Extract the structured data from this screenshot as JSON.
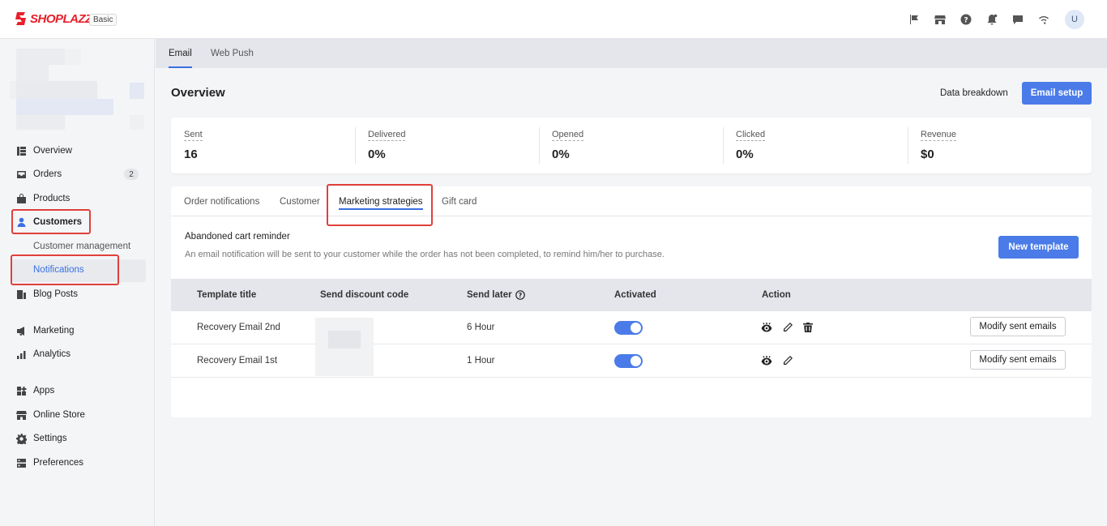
{
  "app": {
    "brand": "SHOPLAZZA",
    "plan": "Basic",
    "user_initial": "U"
  },
  "topbar_icons": [
    "flag-icon",
    "store-icon",
    "help-icon",
    "bell-icon",
    "chat-icon",
    "wifi-icon"
  ],
  "sidebar": {
    "items": [
      {
        "label": "Overview",
        "icon": "overview-icon"
      },
      {
        "label": "Orders",
        "icon": "orders-icon",
        "badge": "2"
      },
      {
        "label": "Products",
        "icon": "products-icon"
      },
      {
        "label": "Customers",
        "icon": "customers-icon",
        "active": true
      },
      {
        "label": "Customer management",
        "sub": true
      },
      {
        "label": "Notifications",
        "sub": true,
        "active": true
      },
      {
        "label": "Blog Posts",
        "icon": "blog-icon"
      },
      {
        "label": "Marketing",
        "icon": "marketing-icon"
      },
      {
        "label": "Analytics",
        "icon": "analytics-icon"
      },
      {
        "label": "Apps",
        "icon": "apps-icon"
      },
      {
        "label": "Online Store",
        "icon": "online-store-icon"
      },
      {
        "label": "Settings",
        "icon": "settings-icon"
      },
      {
        "label": "Preferences",
        "icon": "preferences-icon"
      }
    ]
  },
  "top_tabs": [
    {
      "label": "Email",
      "active": true
    },
    {
      "label": "Web Push"
    }
  ],
  "overview": {
    "title": "Overview",
    "data_breakdown": "Data breakdown",
    "email_setup": "Email setup",
    "stats": [
      {
        "label": "Sent",
        "value": "16"
      },
      {
        "label": "Delivered",
        "value": "0%"
      },
      {
        "label": "Opened",
        "value": "0%"
      },
      {
        "label": "Clicked",
        "value": "0%"
      },
      {
        "label": "Revenue",
        "value": "$0"
      }
    ]
  },
  "panel": {
    "tabs": [
      {
        "label": "Order notifications"
      },
      {
        "label": "Customer"
      },
      {
        "label": "Marketing strategies",
        "active": true
      },
      {
        "label": "Gift card"
      }
    ],
    "section_title": "Abandoned cart reminder",
    "section_desc": "An email notification will be sent to your customer while the order has not been completed, to remind him/her to purchase.",
    "new_template": "New template",
    "columns": [
      "Template title",
      "Send discount code",
      "Send later",
      "Activated",
      "Action"
    ],
    "rows": [
      {
        "title": "Recovery Email 2nd",
        "send_later": "6 Hour",
        "activated": true,
        "actions": [
          "view-icon",
          "edit-icon",
          "delete-icon"
        ],
        "button": "Modify sent emails"
      },
      {
        "title": "Recovery Email 1st",
        "send_later": "1 Hour",
        "activated": true,
        "actions": [
          "view-icon",
          "edit-icon"
        ],
        "button": "Modify sent emails"
      }
    ]
  },
  "colors": {
    "accent": "#4a7be8",
    "highlight": "#e0403a",
    "brand": "#e8202a"
  }
}
